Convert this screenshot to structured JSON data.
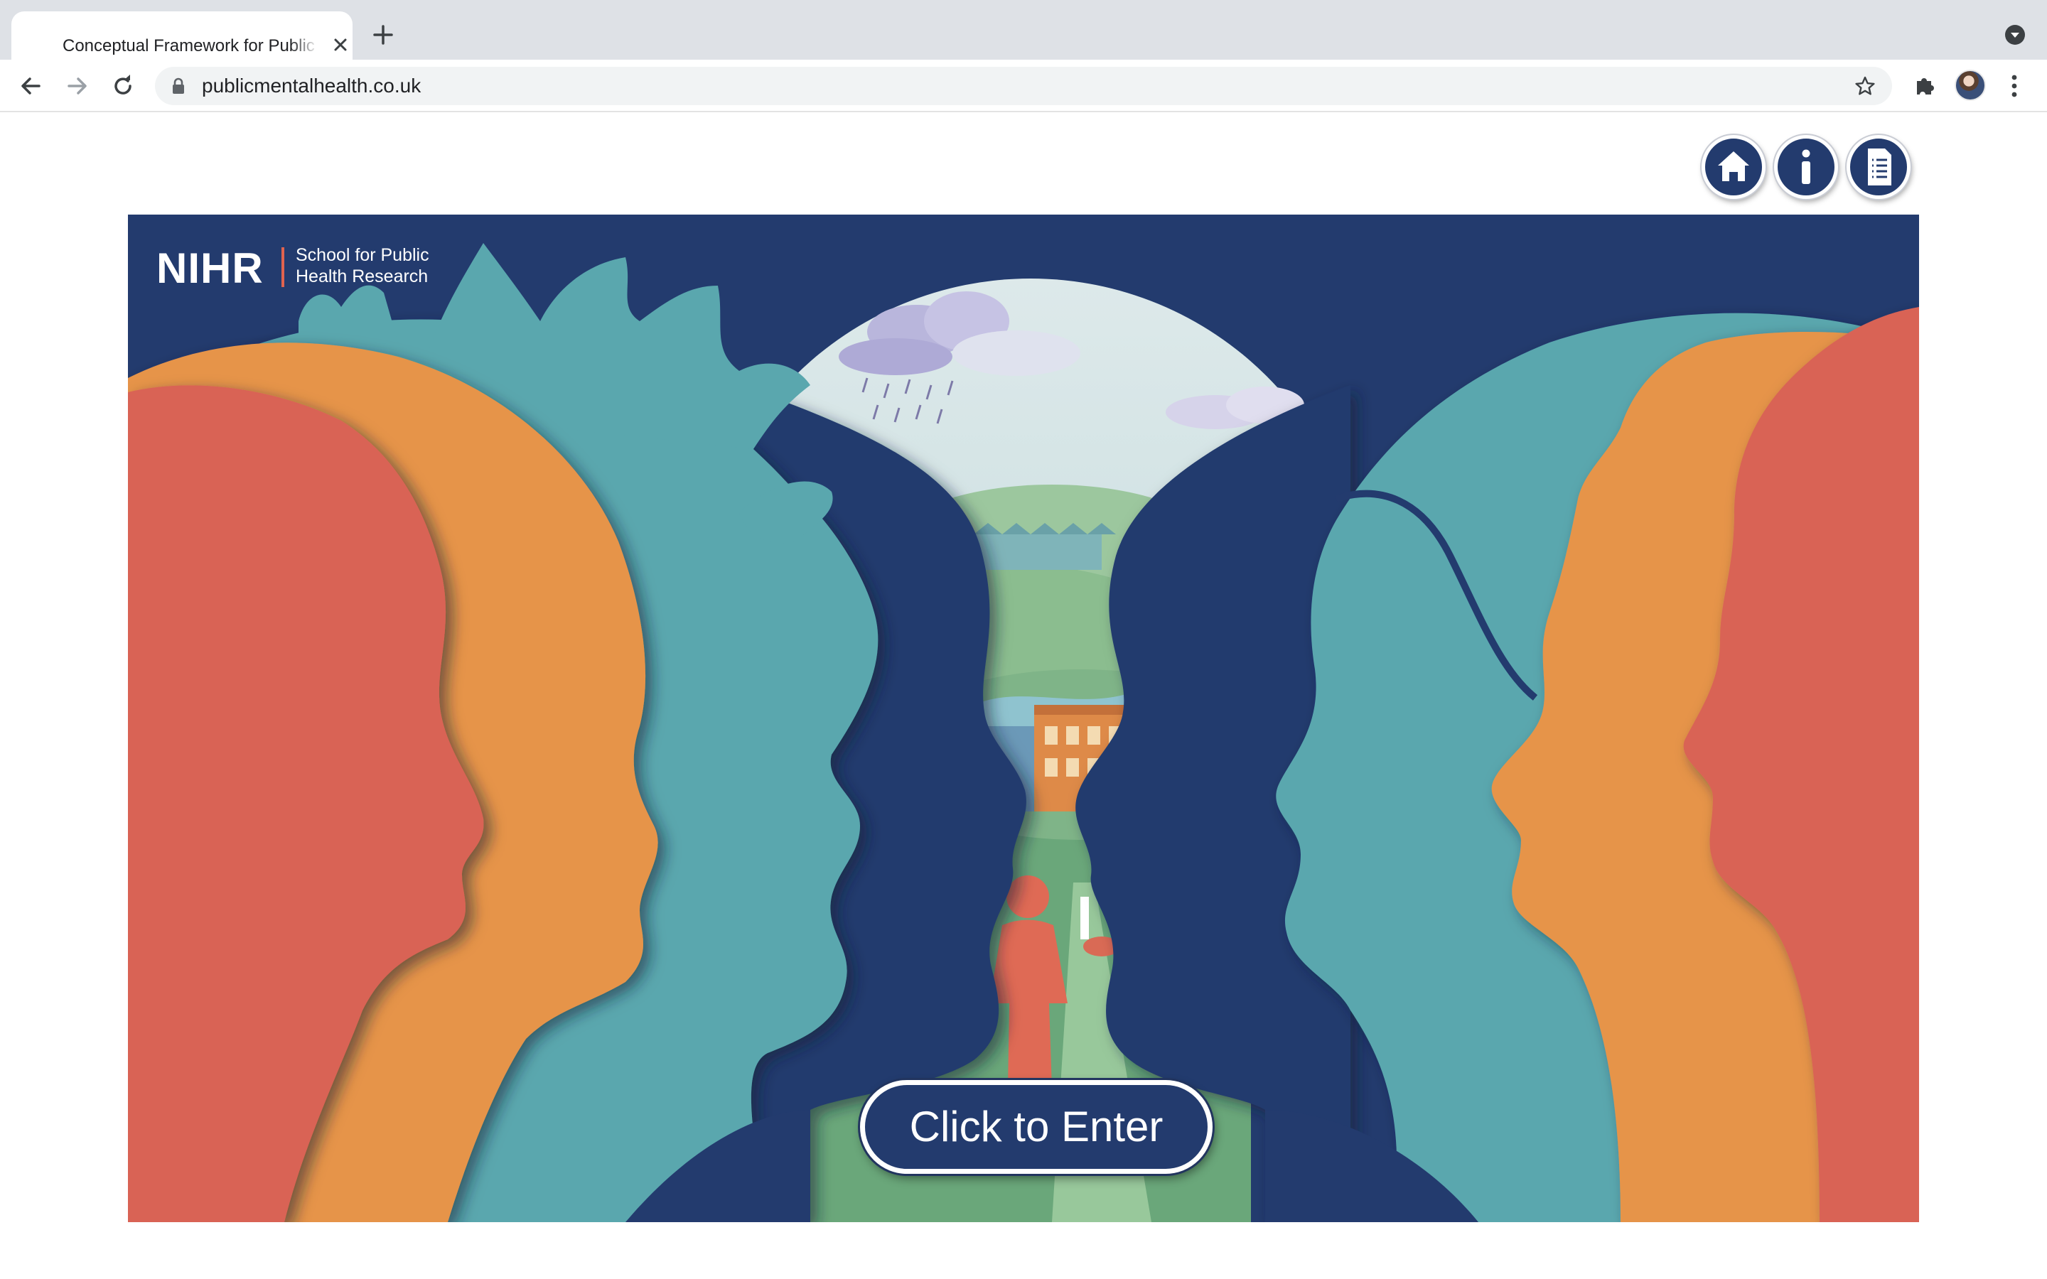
{
  "browser": {
    "tab_title": "Conceptual Framework for Public Mental Health",
    "url": "publicmentalhealth.co.uk",
    "icons": [
      "close-icon",
      "plus-icon",
      "dropdown-icon",
      "back-icon",
      "forward-icon",
      "reload-icon",
      "lock-icon",
      "star-icon",
      "extensions-icon",
      "profile-avatar",
      "menu-icon"
    ]
  },
  "top_nav": {
    "buttons": [
      {
        "name": "home",
        "icon": "home-icon"
      },
      {
        "name": "info",
        "icon": "info-icon"
      },
      {
        "name": "document",
        "icon": "document-icon"
      }
    ]
  },
  "hero": {
    "logo": {
      "brand": "NIHR",
      "subtitle_line1": "School for Public",
      "subtitle_line2": "Health Research"
    },
    "enter_button_label": "Click to Enter"
  },
  "colors": {
    "navy": "#233b6e",
    "coral": "#d96455",
    "orange": "#e6944a",
    "teal": "#5aa7ae",
    "sky": "#cfe1e3",
    "meadow": "#6aa77a"
  }
}
